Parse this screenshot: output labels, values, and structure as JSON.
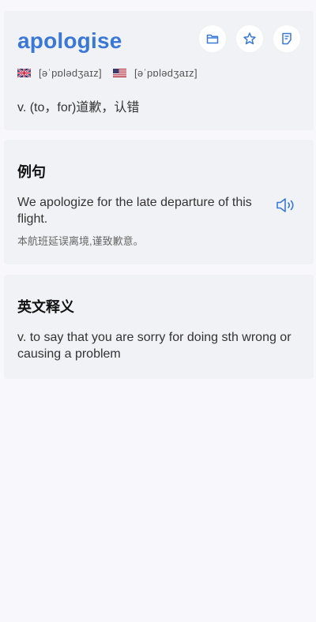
{
  "word": {
    "headword": "apologise",
    "uk_phonetic": "[əˈpɒlədʒaɪz]",
    "us_phonetic": "[əˈpɒlədʒaɪz]",
    "meaning": "v. (to，for)道歉，认错",
    "actions": [
      "folder-icon",
      "star-icon",
      "note-icon"
    ]
  },
  "example": {
    "title": "例句",
    "sentence_en": "We apologize for the late departure of this flight.",
    "sentence_zh": "本航班延误离境,谨致歉意。"
  },
  "definition": {
    "title": "英文释义",
    "text": "v. to say that you are sorry for doing sth wrong or causing a problem"
  },
  "colors": {
    "accent": "#3a78d8",
    "card": "#f1f2f6",
    "background": "#f8f8fc"
  }
}
